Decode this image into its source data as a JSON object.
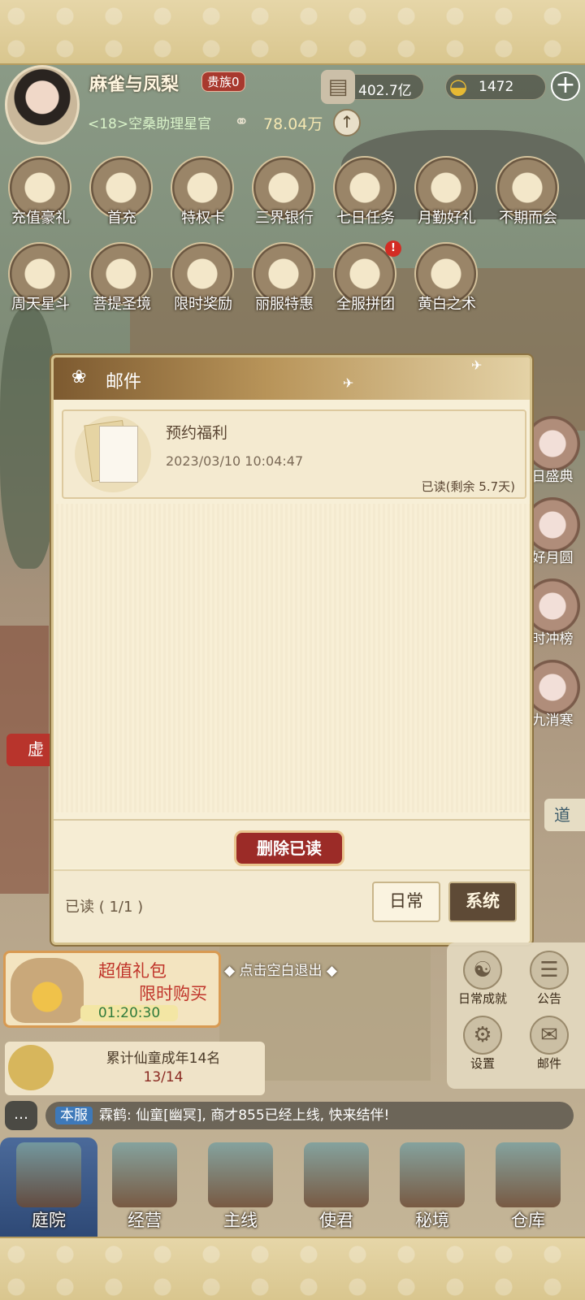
{
  "header": {
    "player_name": "麻雀与凤梨",
    "rank_badge": "贵族0",
    "player_title": "<18>空桑助理星官",
    "silver": "402.7亿",
    "gold": "1472",
    "plus_icon": "plus-icon",
    "coins": "78.04万",
    "up_icon": "arrow-up-icon"
  },
  "features_row1": [
    {
      "label": "充值豪礼"
    },
    {
      "label": "首充"
    },
    {
      "label": "特权卡"
    },
    {
      "label": "三界银行"
    },
    {
      "label": "七日任务"
    },
    {
      "label": "月勤好礼"
    },
    {
      "label": "不期而会"
    }
  ],
  "features_row2": [
    {
      "label": "周天星斗"
    },
    {
      "label": "菩提圣境"
    },
    {
      "label": "限时奖励"
    },
    {
      "label": "丽服特惠"
    },
    {
      "label": "全服拼团",
      "badge": "!"
    },
    {
      "label": "黄白之术"
    }
  ],
  "side_tiles": [
    "日盛典",
    "好月圆",
    "时冲榜",
    "九消寒"
  ],
  "left_tag": "虚",
  "right_tag": "道",
  "mail_dialog": {
    "title": "邮件",
    "items": [
      {
        "title": "预约福利",
        "time": "2023/03/10 10:04:47",
        "status": "已读(剩余 5.7天)"
      }
    ],
    "delete_read_label": "删除已读",
    "read_count": "已读 ( 1/1 )",
    "tabs": [
      {
        "label": "日常",
        "active": false
      },
      {
        "label": "系统",
        "active": true
      }
    ]
  },
  "exit_hint": "点击空白退出",
  "gift_pack": {
    "line1": "超值礼包",
    "line2": "限时购买",
    "timer": "01:20:30"
  },
  "progress": {
    "text": "累计仙童成年14名",
    "value": "13/14"
  },
  "right_menu": [
    {
      "label": "日常成就",
      "icon": "achievement-icon"
    },
    {
      "label": "公告",
      "icon": "notice-icon"
    },
    {
      "label": "设置",
      "icon": "gear-icon"
    },
    {
      "label": "邮件",
      "icon": "mail-icon"
    }
  ],
  "chat": {
    "server_tag": "本服",
    "message": "霖鹤: 仙童[幽冥], 商才855已经上线, 快来结伴!"
  },
  "nav": [
    {
      "label": "庭院",
      "active": true
    },
    {
      "label": "经营",
      "active": false
    },
    {
      "label": "主线",
      "active": false
    },
    {
      "label": "使君",
      "active": false
    },
    {
      "label": "秘境",
      "active": false
    },
    {
      "label": "仓库",
      "active": false
    }
  ],
  "colors": {
    "accent_red": "#9b2b27",
    "gold_frame": "#d5c28e",
    "panel_bg": "#f7efd7",
    "active_tab": "#5e4a36"
  }
}
